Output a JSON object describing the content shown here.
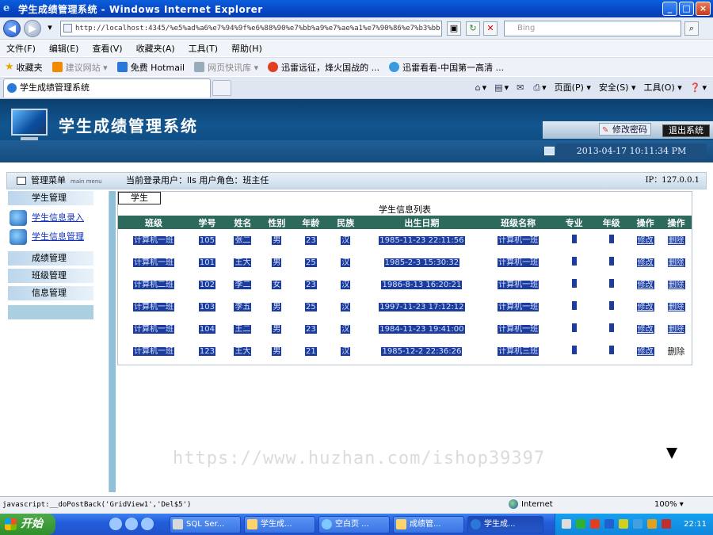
{
  "browser": {
    "window_title": "学生成绩管理系统 - Windows Internet Explorer",
    "address": "http://localhost:4345/%e5%ad%a6%e7%94%9f%e6%88%90%e7%bb%a9%e7%ae%a1%e7%90%86%e7%b3%bb",
    "search_placeholder": "Bing",
    "menu": [
      "文件(F)",
      "编辑(E)",
      "查看(V)",
      "收藏夹(A)",
      "工具(T)",
      "帮助(H)"
    ],
    "favorites": [
      "收藏夹",
      "建议网站 ▾",
      "免费 Hotmail",
      "网页快讯库 ▾",
      "迅雷远征，烽火国战的 ...",
      "迅雷看看-中国第一高清 ..."
    ],
    "tab_title": "学生成绩管理系统",
    "commands": [
      "页面(P) ▾",
      "安全(S) ▾",
      "工具(O) ▾"
    ],
    "status_text": "javascript:__doPostBack('GridView1','Del$5')",
    "zone": "Internet",
    "zoom": "100%"
  },
  "app": {
    "system_title": "学生成绩管理系统",
    "change_password": "修改密码",
    "logout": "退出系统",
    "datetime": "2013-04-17 10:11:34 PM",
    "menu_header": "管理菜单",
    "menu_header_en": "main menu",
    "user_info": "当前登录用户：lls 用户角色：班主任",
    "ip": "IP：127.0.0.1"
  },
  "sidebar": {
    "groups": [
      {
        "label": "学生管理"
      },
      {
        "label": "成绩管理"
      },
      {
        "label": "班级管理"
      },
      {
        "label": "信息管理"
      }
    ],
    "sub_items": [
      {
        "label": "学生信息录入"
      },
      {
        "label": "学生信息管理"
      }
    ]
  },
  "main": {
    "tab": "学生",
    "caption": "学生信息列表",
    "columns": [
      "班级",
      "学号",
      "姓名",
      "性别",
      "年龄",
      "民族",
      "出生日期",
      "班级名称",
      "专业",
      "年级",
      "操作",
      "操作"
    ],
    "rows": [
      {
        "cls": "计算机一班",
        "id": "105",
        "name": "张二",
        "sex": "男",
        "age": "23",
        "nation": "汉",
        "birth": "1985-11-23 22:11:56",
        "cname": "计算机一班",
        "major": "",
        "grade": "",
        "edit": "修改",
        "del": "删除"
      },
      {
        "cls": "计算机一班",
        "id": "101",
        "name": "王大",
        "sex": "男",
        "age": "25",
        "nation": "汉",
        "birth": "1985-2-3 15:30:32",
        "cname": "计算机一班",
        "major": "",
        "grade": "",
        "edit": "修改",
        "del": "删除"
      },
      {
        "cls": "计算机二班",
        "id": "102",
        "name": "李二",
        "sex": "女",
        "age": "23",
        "nation": "汉",
        "birth": "1986-8-13 16:20:21",
        "cname": "计算机一班",
        "major": "",
        "grade": "",
        "edit": "修改",
        "del": "删除"
      },
      {
        "cls": "计算机一班",
        "id": "103",
        "name": "李五",
        "sex": "男",
        "age": "25",
        "nation": "汉",
        "birth": "1997-11-23 17:12:12",
        "cname": "计算机一班",
        "major": "",
        "grade": "",
        "edit": "修改",
        "del": "删除"
      },
      {
        "cls": "计算机一班",
        "id": "104",
        "name": "王二",
        "sex": "男",
        "age": "23",
        "nation": "汉",
        "birth": "1984-11-23 19:41:00",
        "cname": "计算机一班",
        "major": "",
        "grade": "",
        "edit": "修改",
        "del": "删除"
      },
      {
        "cls": "计算机一班",
        "id": "123",
        "name": "王大",
        "sex": "男",
        "age": "21",
        "nation": "汉",
        "birth": "1985-12-2 22:36:26",
        "cname": "计算机三班",
        "major": "",
        "grade": "",
        "edit": "修改",
        "del": "删除"
      }
    ]
  },
  "watermark": "https://www.huzhan.com/ishop39397",
  "taskbar": {
    "start": "开始",
    "items": [
      "SQL Ser...",
      "学生成...",
      "空白页 ...",
      "成绩管...",
      "学生成..."
    ],
    "clock": "22:11"
  }
}
